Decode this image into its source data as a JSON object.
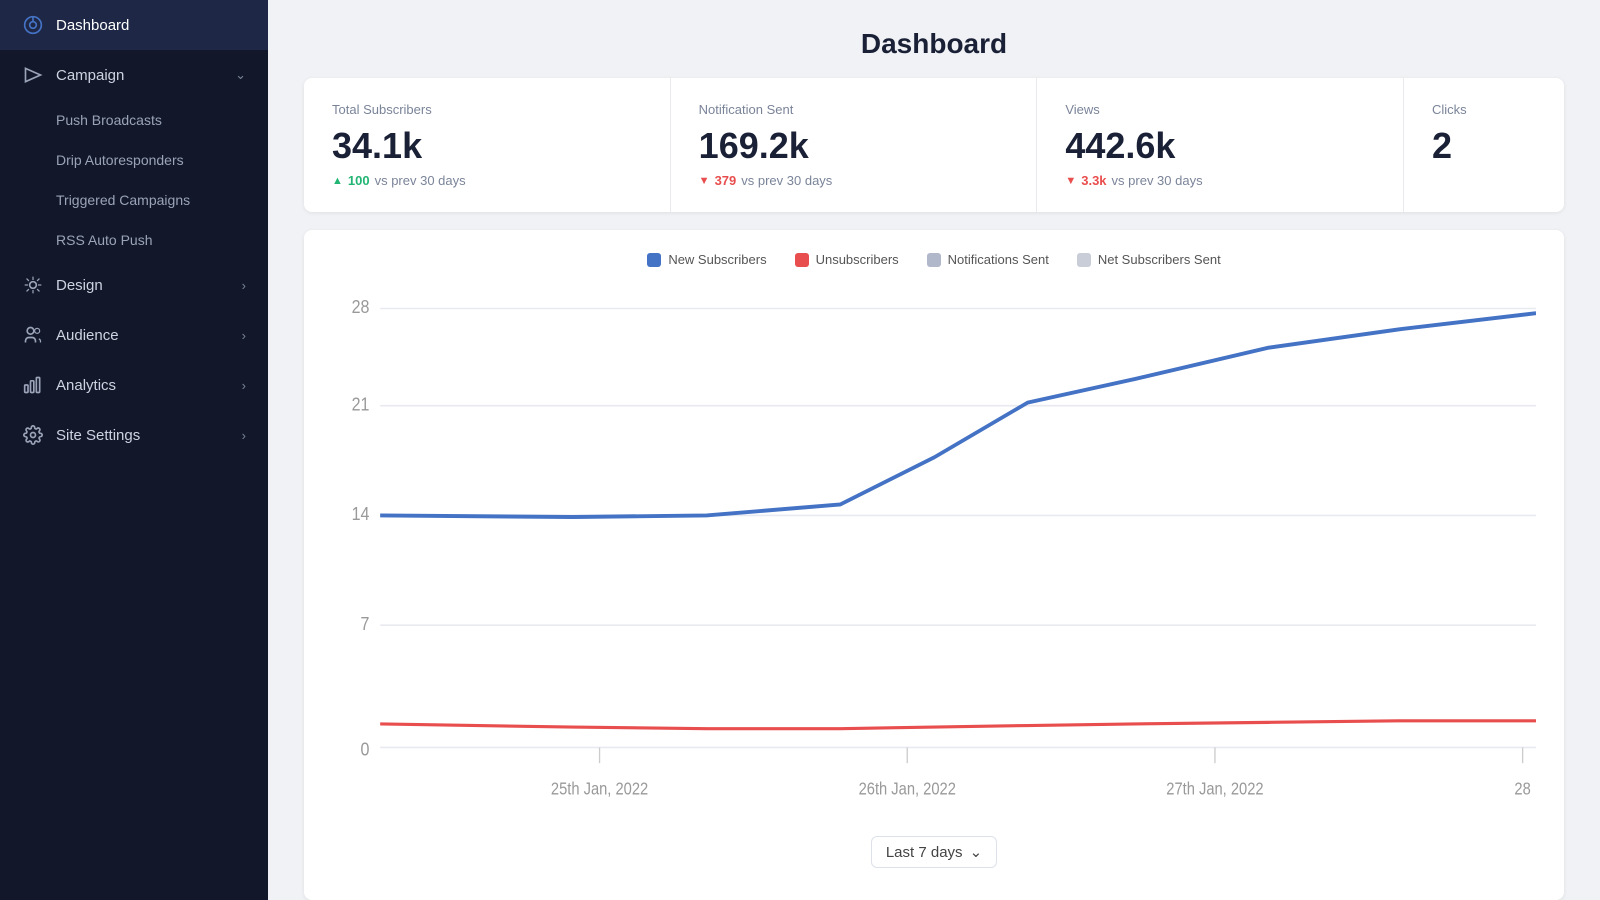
{
  "sidebar": {
    "items": [
      {
        "id": "dashboard",
        "label": "Dashboard",
        "icon": "dashboard-icon",
        "active": true,
        "hasChevron": false,
        "expanded": false
      },
      {
        "id": "campaign",
        "label": "Campaign",
        "icon": "campaign-icon",
        "active": false,
        "hasChevron": true,
        "expanded": true
      },
      {
        "id": "design",
        "label": "Design",
        "icon": "design-icon",
        "active": false,
        "hasChevron": true,
        "expanded": false
      },
      {
        "id": "audience",
        "label": "Audience",
        "icon": "audience-icon",
        "active": false,
        "hasChevron": true,
        "expanded": false
      },
      {
        "id": "analytics",
        "label": "Analytics",
        "icon": "analytics-icon",
        "active": false,
        "hasChevron": true,
        "expanded": false
      },
      {
        "id": "site-settings",
        "label": "Site Settings",
        "icon": "settings-icon",
        "active": false,
        "hasChevron": true,
        "expanded": false
      }
    ],
    "campaign_sub_items": [
      {
        "id": "push-broadcasts",
        "label": "Push Broadcasts",
        "active": false
      },
      {
        "id": "drip-autoresponders",
        "label": "Drip Autoresponders",
        "active": false
      },
      {
        "id": "triggered-campaigns",
        "label": "Triggered Campaigns",
        "active": false
      },
      {
        "id": "rss-auto-push",
        "label": "RSS Auto Push",
        "active": false
      }
    ]
  },
  "page": {
    "title": "Dashboard"
  },
  "stats": [
    {
      "id": "total-subscribers",
      "label": "Total Subscribers",
      "value": "34.1k",
      "change_val": "100",
      "change_dir": "up",
      "change_text": "vs prev 30 days"
    },
    {
      "id": "notification-sent",
      "label": "Notification Sent",
      "value": "169.2k",
      "change_val": "379",
      "change_dir": "down",
      "change_text": "vs prev 30 days"
    },
    {
      "id": "views",
      "label": "Views",
      "value": "442.6k",
      "change_val": "3.3k",
      "change_dir": "down",
      "change_text": "vs prev 30 days"
    },
    {
      "id": "clicks",
      "label": "Clicks",
      "value": "2",
      "change_val": "",
      "change_dir": "",
      "change_text": ""
    }
  ],
  "chart": {
    "legend": [
      {
        "id": "new-subscribers",
        "label": "New Subscribers",
        "color": "#4472c4"
      },
      {
        "id": "unsubscribers",
        "label": "Unsubscribers",
        "color": "#e94e4e"
      },
      {
        "id": "notifications-sent",
        "label": "Notifications Sent",
        "color": "#b0b8c9"
      },
      {
        "id": "net-subscribers-sent",
        "label": "Net Subscribers Sent",
        "color": "#c8cdd8"
      }
    ],
    "y_labels": [
      "28",
      "21",
      "14",
      "7",
      "0"
    ],
    "x_labels": [
      "25th Jan, 2022",
      "26th Jan, 2022",
      "27th Jan, 2022",
      "28"
    ]
  },
  "date_filter": {
    "label": "Last 7 days"
  }
}
